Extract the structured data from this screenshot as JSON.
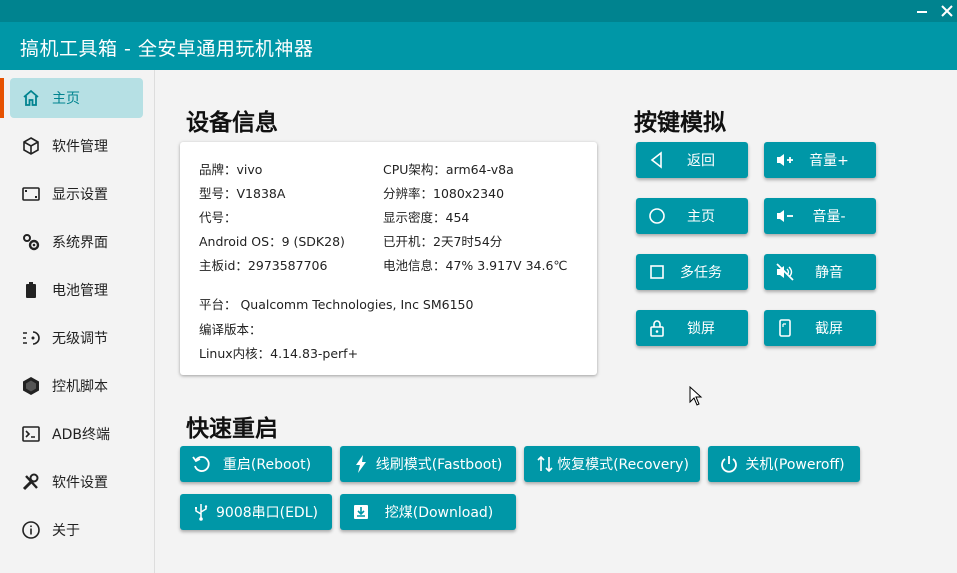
{
  "window": {
    "title": "搞机工具箱 - 全安卓通用玩机神器",
    "controls": [
      "minimize",
      "close"
    ]
  },
  "sidebar": {
    "items": [
      {
        "label": "主页",
        "icon": "home-icon",
        "active": true
      },
      {
        "label": "软件管理",
        "icon": "package-icon",
        "active": false
      },
      {
        "label": "显示设置",
        "icon": "display-icon",
        "active": false
      },
      {
        "label": "系统界面",
        "icon": "gears-icon",
        "active": false
      },
      {
        "label": "电池管理",
        "icon": "battery-icon",
        "active": false
      },
      {
        "label": "无级调节",
        "icon": "slider-icon",
        "active": false
      },
      {
        "label": "控机脚本",
        "icon": "hexagon-icon",
        "active": false
      },
      {
        "label": "ADB终端",
        "icon": "terminal-icon",
        "active": false
      },
      {
        "label": "软件设置",
        "icon": "tools-icon",
        "active": false
      },
      {
        "label": "关于",
        "icon": "info-icon",
        "active": false
      }
    ]
  },
  "device_info": {
    "title": "设备信息",
    "brand": "品牌：vivo",
    "model": "型号：V1838A",
    "codename": "代号：",
    "android": "Android OS：9 (SDK28)",
    "board_id": "主板id：2973587706",
    "cpu": "CPU架构：arm64-v8a",
    "resolution": "分辨率：1080x2340",
    "density": "显示密度：454",
    "uptime": "已开机：2天7时54分",
    "battery": "电池信息：47%  3.917V  34.6℃",
    "platform": "平台：  Qualcomm Technologies, Inc SM6150",
    "build": "编译版本：",
    "kernel": "Linux内核：4.14.83-perf+"
  },
  "key_sim": {
    "title": "按键模拟",
    "back": "返回",
    "vol_up": "音量+",
    "home": "主页",
    "vol_down": "音量-",
    "recents": "多任务",
    "mute": "静音",
    "lock": "锁屏",
    "screenshot": "截屏"
  },
  "reboot": {
    "title": "快速重启",
    "reboot": "重启(Reboot)",
    "fastboot": "线刷模式(Fastboot)",
    "recovery": "恢复模式(Recovery)",
    "poweroff": "关机(Poweroff)",
    "edl": "9008串口(EDL)",
    "download": "挖煤(Download)"
  },
  "colors": {
    "accent": "#0097a7",
    "accent_dark": "#00838f",
    "active_bg": "#b6e0e4",
    "active_marker": "#e65100"
  }
}
